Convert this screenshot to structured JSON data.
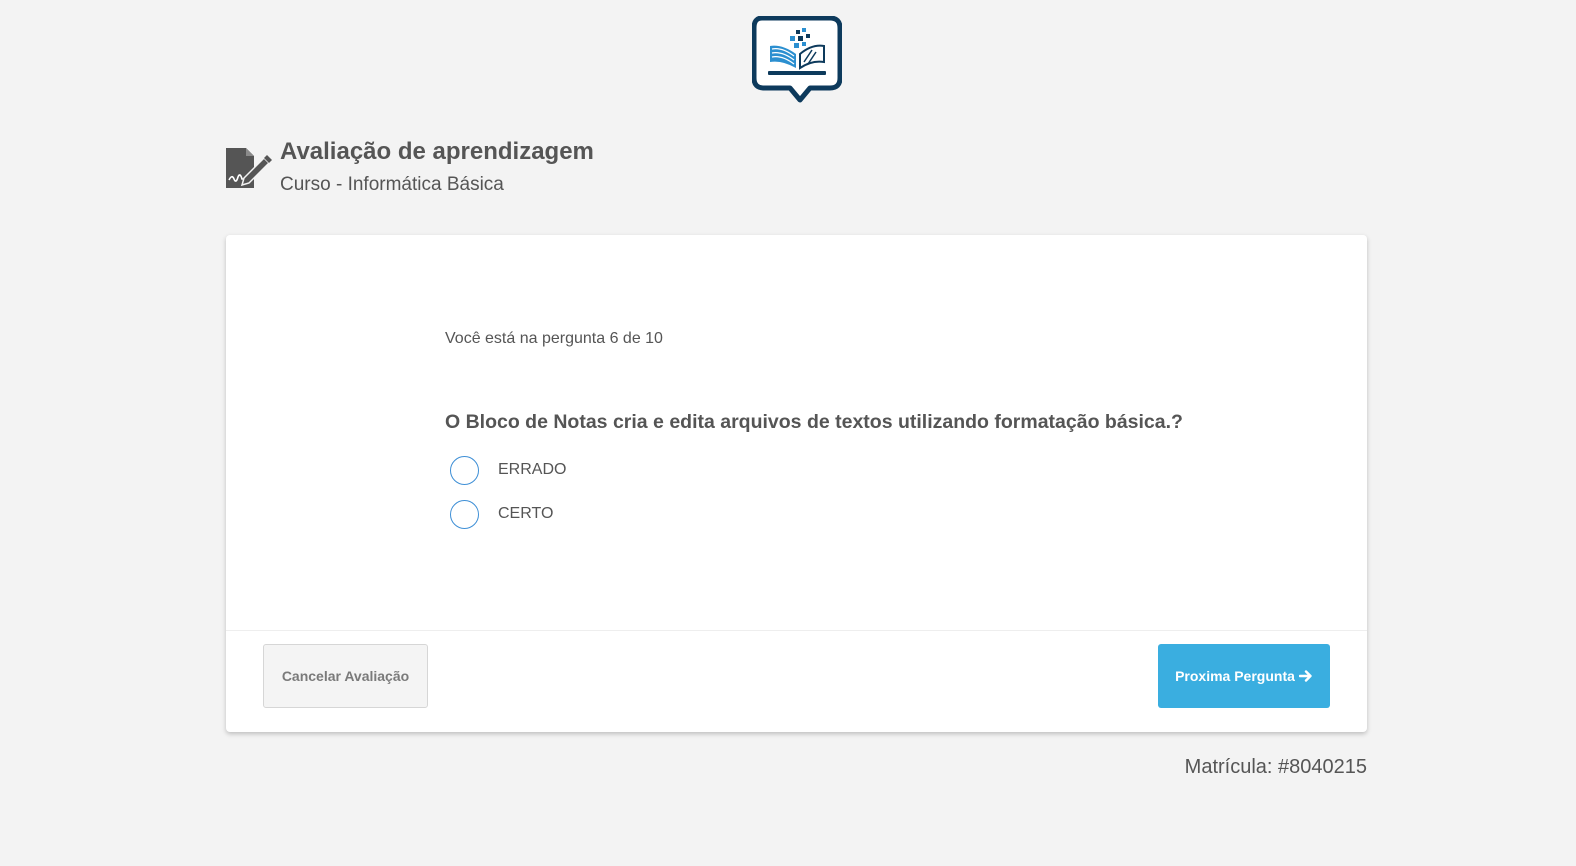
{
  "header": {
    "title": "Avaliação de aprendizagem",
    "subtitle": "Curso - Informática Básica"
  },
  "quiz": {
    "progress_text": "Você está na pergunta 6 de 10",
    "question": "O Bloco de Notas cria e edita arquivos de textos utilizando formatação básica.?",
    "options": [
      {
        "label": "ERRADO"
      },
      {
        "label": "CERTO"
      }
    ]
  },
  "actions": {
    "cancel_label": "Cancelar Avaliação",
    "next_label": "Proxima Pergunta"
  },
  "footer": {
    "registration": "Matrícula: #8040215"
  },
  "icons": {
    "logo": "book-chat-logo-icon",
    "header": "signature-pen-icon",
    "next": "arrow-right-icon"
  },
  "colors": {
    "primary_button": "#3aaee0",
    "radio_border": "#3e8fd6",
    "logo_dark": "#0d3a5c",
    "logo_accent": "#2b8fd0"
  }
}
